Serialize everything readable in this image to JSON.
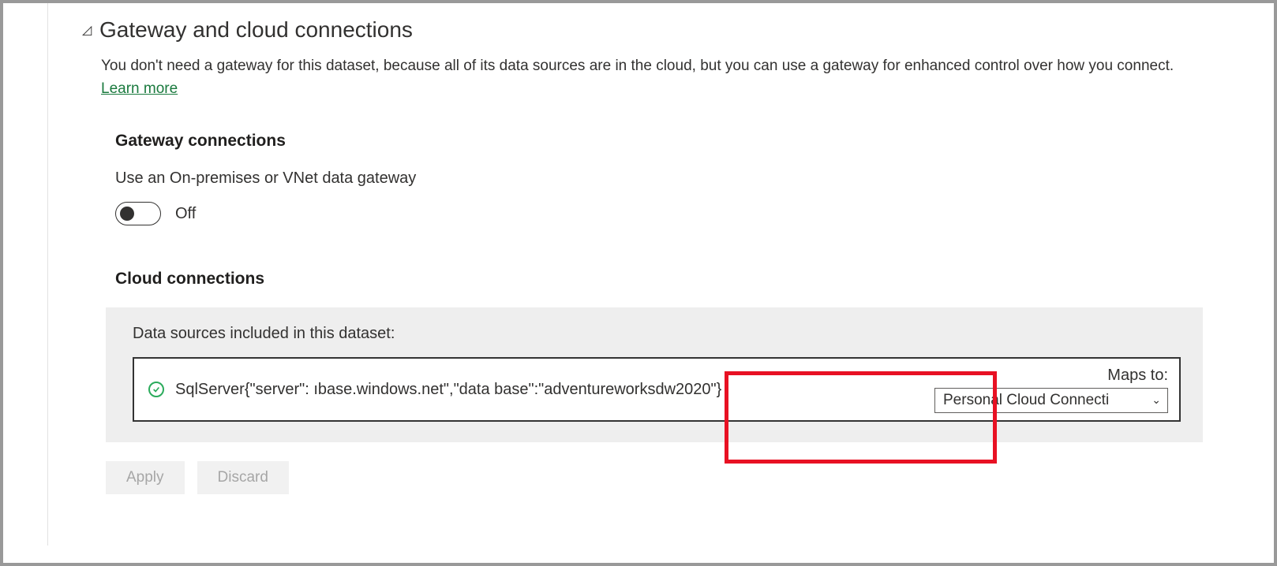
{
  "section": {
    "title": "Gateway and cloud connections",
    "description_pre": "You don't need a gateway for this dataset, because all of its data sources are in the cloud, but you can use a gateway for enhanced control over how you connect. ",
    "learn_more": "Learn more"
  },
  "gateway": {
    "heading": "Gateway connections",
    "toggle_label": "Use an On-premises or VNet data gateway",
    "toggle_state": "Off"
  },
  "cloud": {
    "heading": "Cloud connections",
    "panel_label": "Data sources included in this dataset:",
    "source_text": "SqlServer{\"server\":                          ıbase.windows.net\",\"data base\":\"adventureworksdw2020\"}",
    "maps_label": "Maps to:",
    "dropdown_value": "Personal Cloud Connecti"
  },
  "footer": {
    "apply": "Apply",
    "discard": "Discard"
  }
}
